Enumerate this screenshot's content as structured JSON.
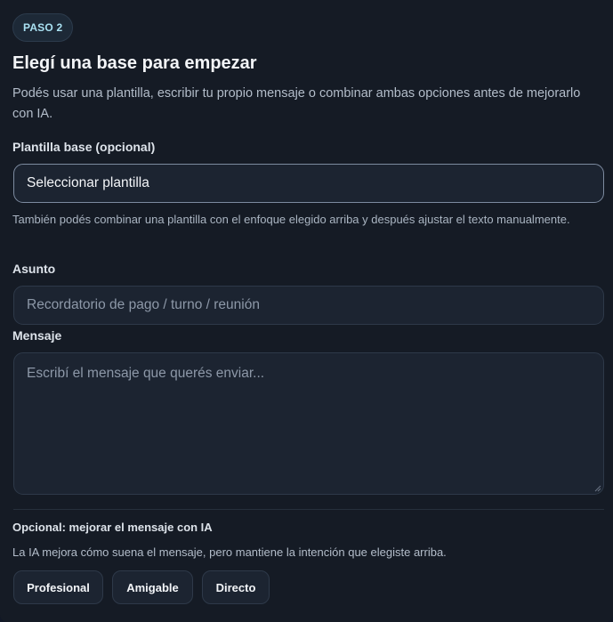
{
  "step": {
    "badge": "PASO 2",
    "title": "Elegí una base para empezar",
    "description": "Podés usar una plantilla, escribir tu propio mensaje o combinar ambas opciones antes de mejorarlo con IA."
  },
  "template": {
    "label": "Plantilla base (opcional)",
    "selected": "Seleccionar plantilla",
    "hint": "También podés combinar una plantilla con el enfoque elegido arriba y después ajustar el texto manualmente."
  },
  "subject": {
    "label": "Asunto",
    "placeholder": "Recordatorio de pago / turno / reunión"
  },
  "message": {
    "label": "Mensaje",
    "placeholder": "Escribí el mensaje que querés enviar..."
  },
  "ai": {
    "title": "Opcional: mejorar el mensaje con IA",
    "description": "La IA mejora cómo suena el mensaje, pero mantiene la intención que elegiste arriba.",
    "tones": [
      "Profesional",
      "Amigable",
      "Directo"
    ]
  },
  "colors": {
    "background": "#151b25",
    "field": "#1c2431",
    "badge_text": "#a9e1f2"
  }
}
